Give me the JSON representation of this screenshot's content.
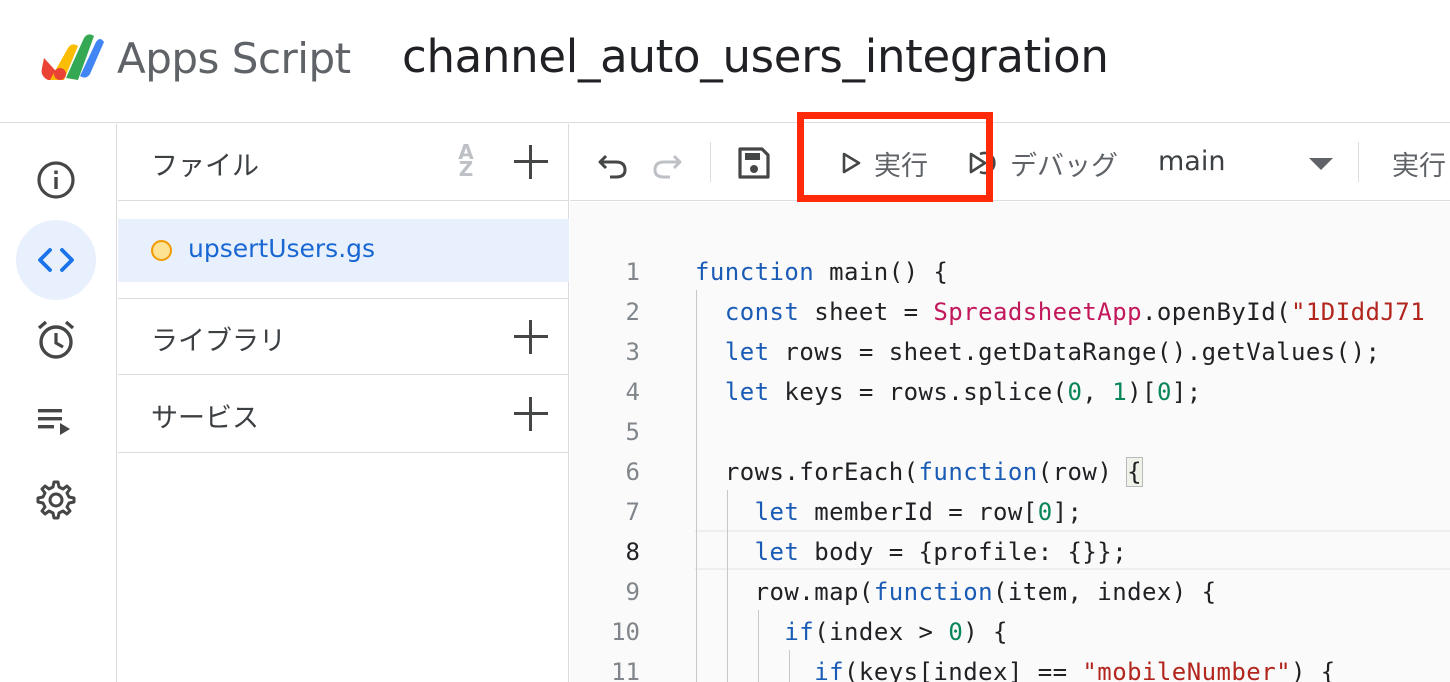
{
  "header": {
    "app_name": "Apps Script",
    "project_title": "channel_auto_users_integration"
  },
  "rail": {
    "items": [
      {
        "name": "overview",
        "icon": "info-icon"
      },
      {
        "name": "editor",
        "icon": "code-icon",
        "active": true
      },
      {
        "name": "triggers",
        "icon": "alarm-icon"
      },
      {
        "name": "executions",
        "icon": "executions-icon"
      },
      {
        "name": "settings",
        "icon": "gear-icon"
      }
    ]
  },
  "files_panel": {
    "files_label": "ファイル",
    "sort_icon_label": "AZ",
    "files": [
      {
        "name": "upsertUsers.gs",
        "selected": true
      }
    ],
    "libraries_label": "ライブラリ",
    "services_label": "サービス"
  },
  "toolbar": {
    "run_label": "実行",
    "debug_label": "デバッグ",
    "function_selected": "main",
    "execution_log_label": "実行"
  },
  "editor": {
    "lines": [
      {
        "num": "1"
      },
      {
        "num": "2"
      },
      {
        "num": "3"
      },
      {
        "num": "4"
      },
      {
        "num": "5"
      },
      {
        "num": "6"
      },
      {
        "num": "7"
      },
      {
        "num": "8",
        "current": true
      },
      {
        "num": "9"
      },
      {
        "num": "10"
      },
      {
        "num": "11"
      }
    ],
    "code": {
      "l1": [
        "function",
        " main() {"
      ],
      "l2": [
        "const",
        " sheet = ",
        "SpreadsheetApp",
        ".openById(",
        "\"1DIddJ71"
      ],
      "l3": [
        "let",
        " rows = sheet.getDataRange().getValues();"
      ],
      "l4": [
        "let",
        " keys = rows.splice(",
        "0",
        ", ",
        "1",
        ")[",
        "0",
        "];"
      ],
      "l5": [
        ""
      ],
      "l6": [
        "rows.forEach(",
        "function",
        "(row) ",
        "{"
      ],
      "l7": [
        "let",
        " memberId = row[",
        "0",
        "];"
      ],
      "l8": [
        "let",
        " body = {profile: {}};"
      ],
      "l9": [
        "row.map(",
        "function",
        "(item, index) {"
      ],
      "l10": [
        "if",
        "(index > ",
        "0",
        ") {"
      ],
      "l11": [
        "if",
        "(keys[index] == ",
        "\"mobileNumber\"",
        ") {"
      ]
    }
  },
  "colors": {
    "keyword": "#1a5bb5",
    "class": "#c2185b",
    "string": "#b3261e",
    "number": "#098658",
    "highlight_box": "#ff2a0a",
    "active_rail": "#e8f0fe"
  }
}
